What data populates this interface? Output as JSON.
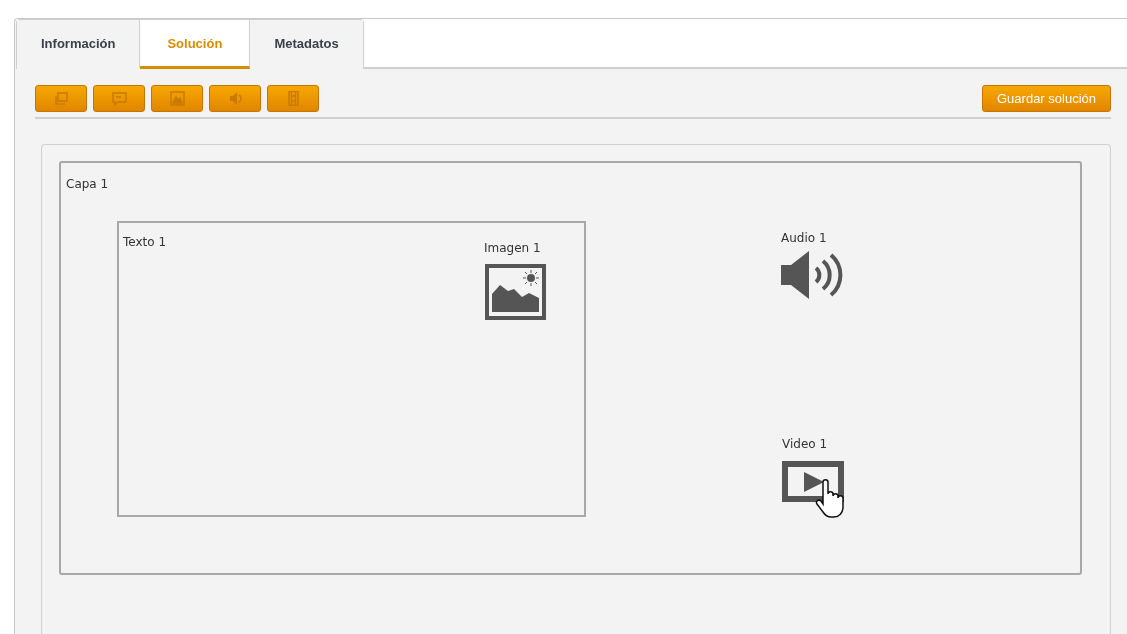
{
  "tabs": [
    {
      "label": "Información",
      "selected": false
    },
    {
      "label": "Solución",
      "selected": true
    },
    {
      "label": "Metadatos",
      "selected": false
    }
  ],
  "toolbar": {
    "tools": [
      {
        "kind": "layer"
      },
      {
        "kind": "text"
      },
      {
        "kind": "image"
      },
      {
        "kind": "audio"
      },
      {
        "kind": "video"
      }
    ],
    "save_button": "Guardar solución"
  },
  "layer": {
    "title": "Capa 1",
    "elements": [
      {
        "kind": "text",
        "label": "Texto 1"
      },
      {
        "kind": "image",
        "label": "Imagen 1"
      },
      {
        "kind": "audio",
        "label": "Audio 1"
      },
      {
        "kind": "video",
        "label": "Video 1"
      }
    ]
  }
}
